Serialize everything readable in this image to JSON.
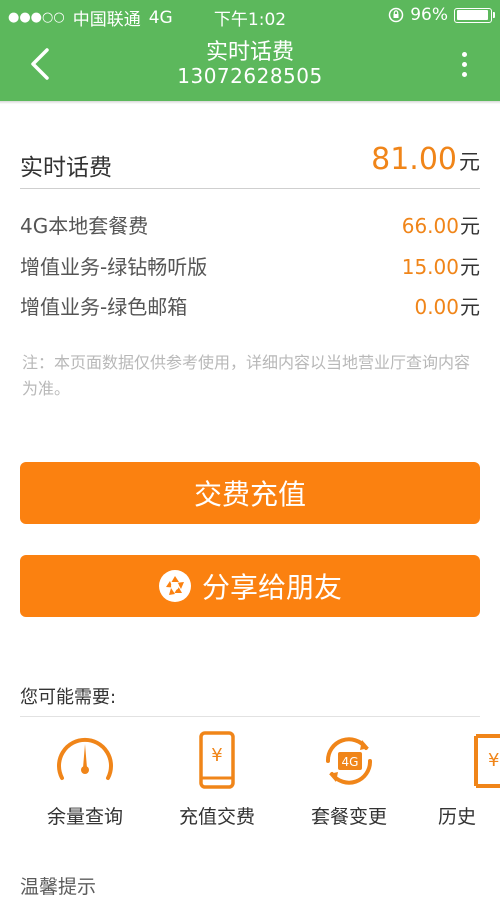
{
  "status_bar": {
    "signal": "●●●○○",
    "carrier": "中国联通",
    "network": "4G",
    "time": "下午1:02",
    "battery_percent": "96%",
    "battery_level": 0.96
  },
  "nav": {
    "title": "实时话费",
    "subtitle": "13072628505"
  },
  "total": {
    "label": "实时话费",
    "amount": "81.00",
    "unit": "元"
  },
  "fees": [
    {
      "name": "4G本地套餐费",
      "value": "66.00",
      "unit": "元"
    },
    {
      "name": "增值业务-绿钻畅听版",
      "value": "15.00",
      "unit": "元"
    },
    {
      "name": "增值业务-绿色邮箱",
      "value": "0.00",
      "unit": "元"
    }
  ],
  "note": "注：本页面数据仅供参考使用，详细内容以当地营业厅查询内容为准。",
  "buttons": {
    "recharge": "交费充值",
    "share": "分享给朋友"
  },
  "suggest": {
    "title": "您可能需要:",
    "items": [
      {
        "label": "余量查询",
        "icon": "gauge-icon"
      },
      {
        "label": "充值交费",
        "icon": "phone-yen-icon"
      },
      {
        "label": "套餐变更",
        "icon": "4g-refresh-icon"
      },
      {
        "label": "历史",
        "icon": "history-bill-icon"
      }
    ]
  },
  "tips_title": "温馨提示",
  "colors": {
    "header_green": "#5cb85c",
    "accent_orange": "#fb8110",
    "amount_orange": "#f08519"
  }
}
